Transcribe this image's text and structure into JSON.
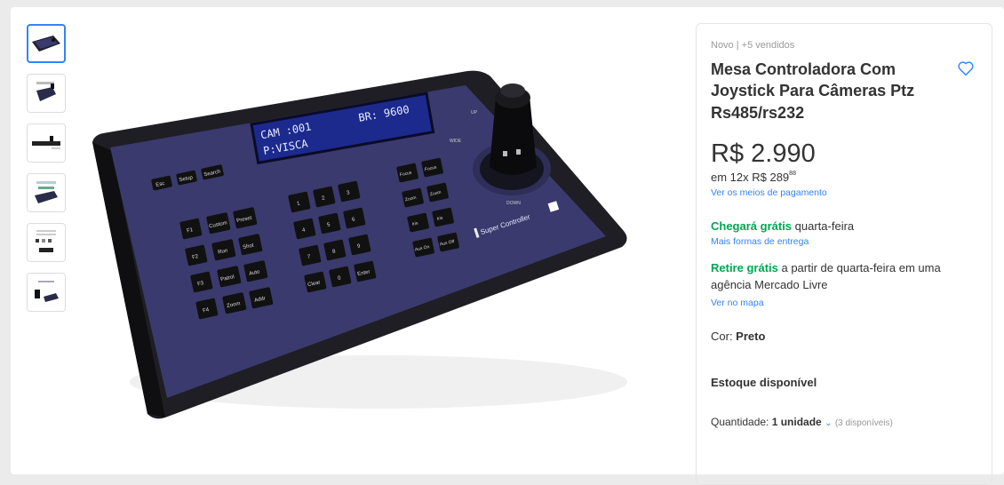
{
  "product": {
    "condition_sold": "Novo  |  +5 vendidos",
    "title": "Mesa Controladora Com Joystick Para Câmeras Ptz Rs485/rs232",
    "price": "R$ 2.990",
    "installments_prefix": "em 12x R$ 289",
    "installments_cents": "88",
    "payment_link": "Ver os meios de pagamento"
  },
  "shipping": {
    "free_label": "Chegará grátis",
    "free_day": " quarta-feira",
    "more_options_link": "Mais formas de entrega"
  },
  "pickup": {
    "free_label": "Retire grátis",
    "text": " a partir de quarta-feira em uma agência Mercado Livre",
    "map_link": "Ver no mapa"
  },
  "color": {
    "label": "Cor: ",
    "value": "Preto"
  },
  "stock": {
    "label": "Estoque disponível"
  },
  "quantity": {
    "label": "Quantidade: ",
    "value": "1 unidade",
    "available": "(3 disponíveis)"
  },
  "device": {
    "lcd_line1": "CAM :001",
    "lcd_line1_right": "BR: 9600",
    "lcd_line2": "P:VISCA",
    "brand": "Super Controller",
    "keys_left": [
      "Esc",
      "Setup",
      "Search"
    ],
    "fkeys": [
      "F1",
      "F2",
      "F3",
      "F4"
    ],
    "fkey_mid": [
      "Custom",
      "Run",
      "Patrol",
      "Zoom"
    ],
    "fkey_right": [
      "Preset",
      "Shot",
      "Auto",
      "Addr"
    ],
    "numpad": [
      "1",
      "2",
      "3",
      "4",
      "5",
      "6",
      "7",
      "8",
      "9",
      "Clear",
      "0",
      "Enter"
    ],
    "right_keys": [
      "Focus",
      "Focus",
      "Zoom",
      "Zoom",
      "Iris",
      "Iris",
      "Aux On",
      "Aux Off"
    ],
    "joystick_labels": [
      "UP",
      "WIDE",
      "DOWN"
    ]
  },
  "colors": {
    "accent": "#3483fa",
    "green": "#00a650",
    "panel": "#3a3a6e"
  }
}
